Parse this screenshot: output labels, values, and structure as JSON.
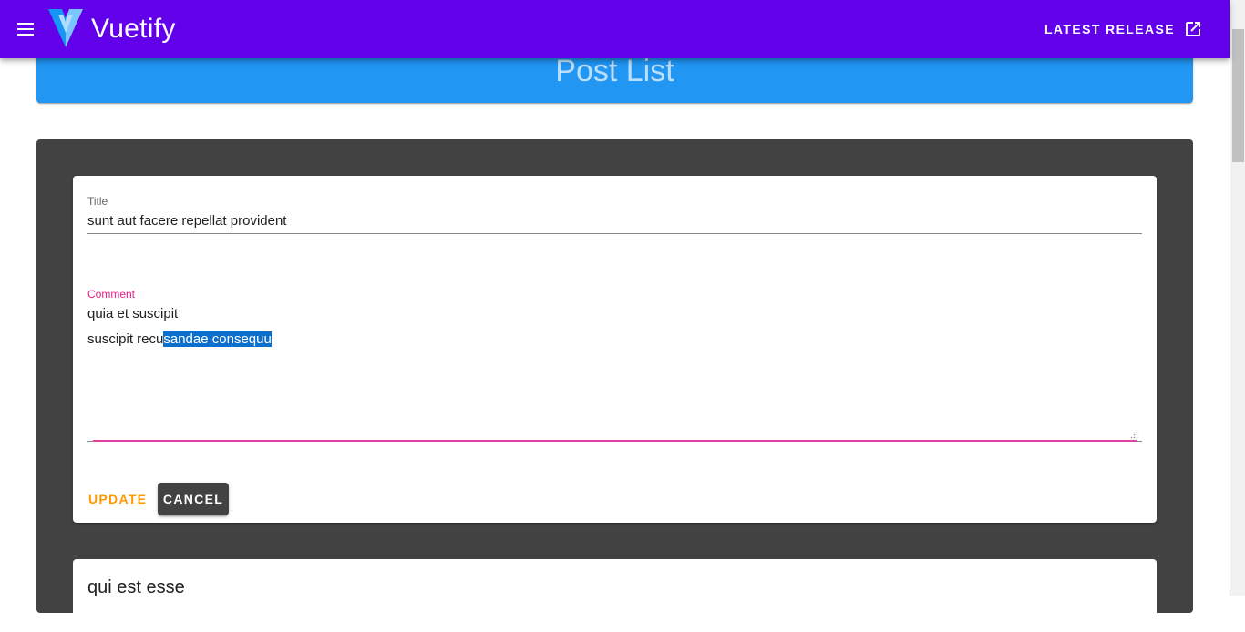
{
  "app_bar": {
    "brand": "Vuetify",
    "release_label": "LATEST RELEASE",
    "color": "#6200ea"
  },
  "banner": {
    "title": "Post List",
    "color": "#2196f3"
  },
  "edit_card": {
    "title_label": "Title",
    "title_value": "sunt aut facere repellat provident",
    "comment_label": "Comment",
    "comment_line1": "quia et suscipit",
    "comment_line2_plain": "suscipit recu",
    "comment_line2_selected": "sandae consequu",
    "update_label": "UPDATE",
    "cancel_label": "CANCEL",
    "accent_color": "#e91e8c",
    "update_color": "#ff9800"
  },
  "next_card": {
    "title": "qui est esse"
  },
  "icons": {
    "menu": "menu-icon",
    "logo": "vuetify-logo-icon",
    "external": "open-in-new-icon"
  }
}
